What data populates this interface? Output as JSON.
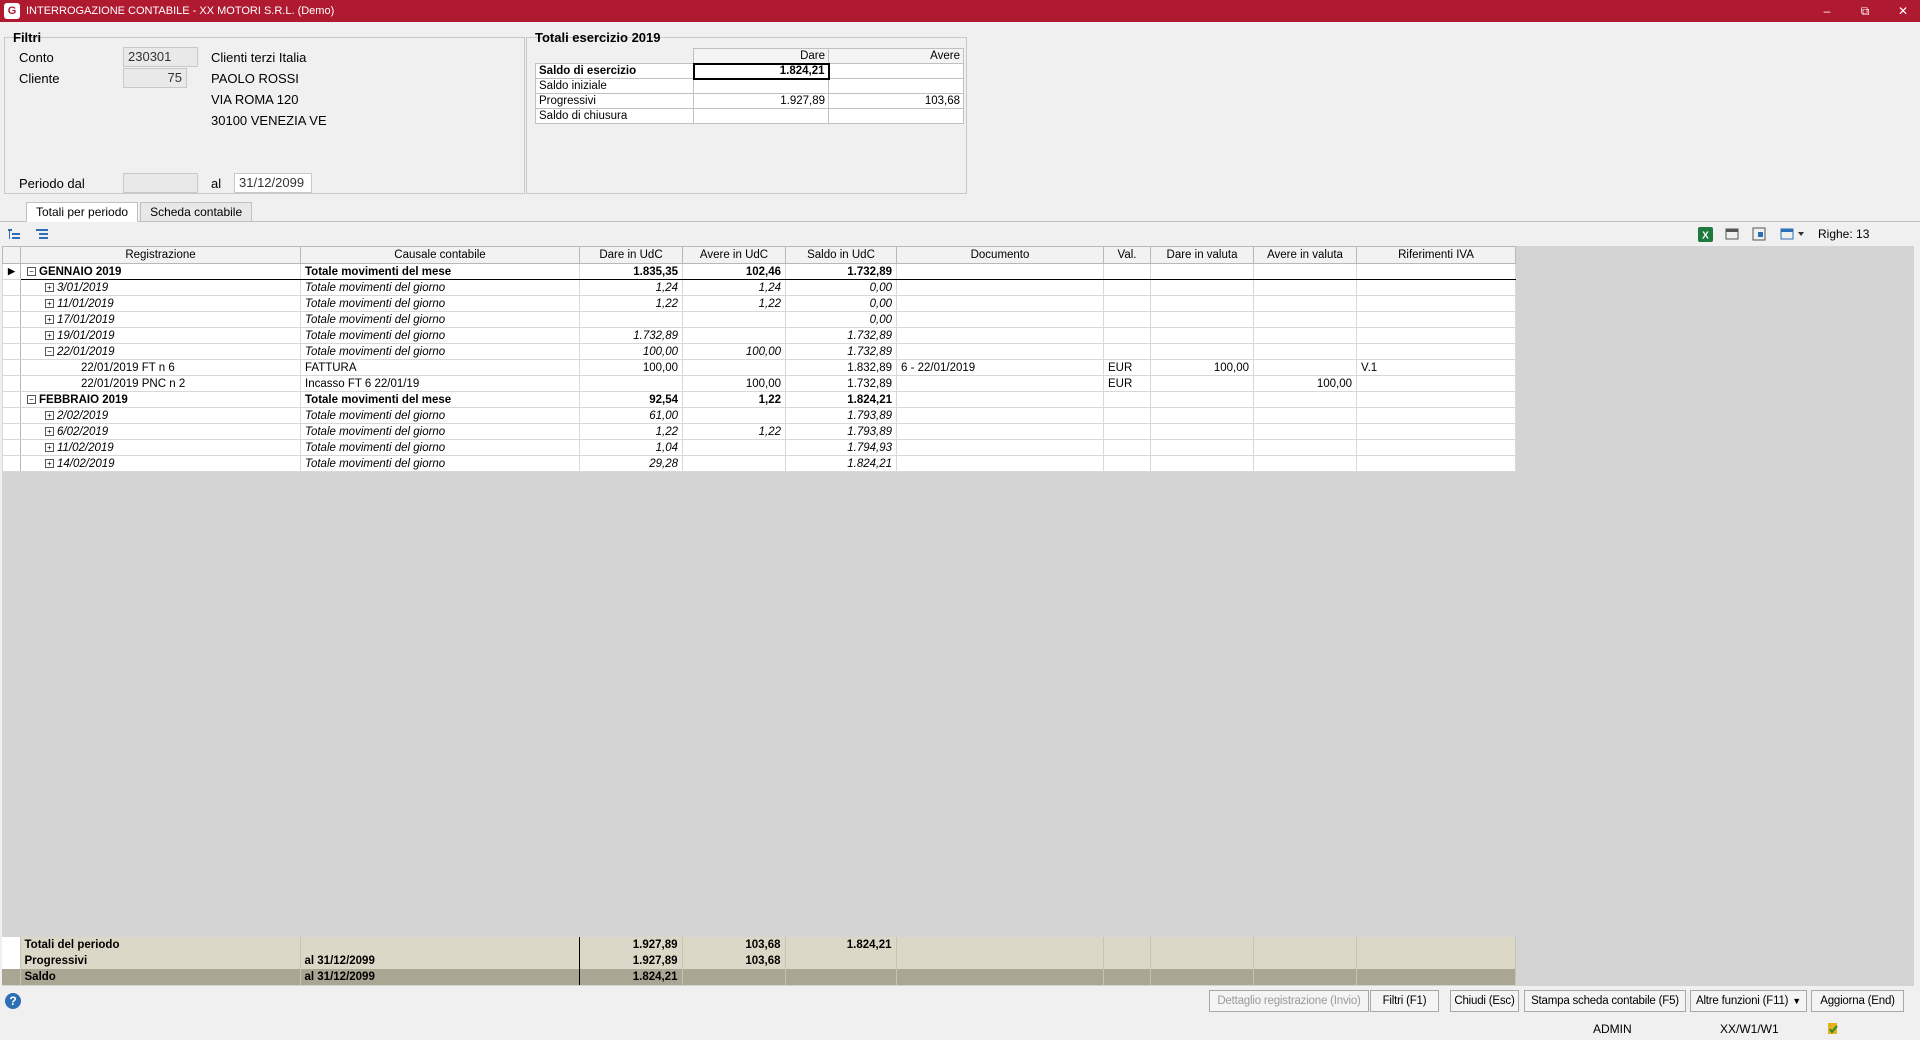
{
  "titlebar": {
    "title": "INTERROGAZIONE CONTABILE - XX MOTORI S.R.L. (Demo)"
  },
  "filters": {
    "title": "Filtri",
    "conto_label": "Conto",
    "conto_value": "230301",
    "conto_desc": "Clienti terzi Italia",
    "cliente_label": "Cliente",
    "cliente_value": "75",
    "cliente_name": "PAOLO ROSSI",
    "address1": "VIA ROMA 120",
    "address2": "30100 VENEZIA VE",
    "periodo_label": "Periodo dal",
    "periodo_dal": "",
    "al_label": "al",
    "periodo_al": "31/12/2099"
  },
  "totals": {
    "title": "Totali esercizio 2019",
    "col_dare": "Dare",
    "col_avere": "Avere",
    "rows": [
      {
        "label": "Saldo di esercizio",
        "dare": "1.824,21",
        "avere": ""
      },
      {
        "label": "Saldo iniziale",
        "dare": "",
        "avere": ""
      },
      {
        "label": "Progressivi",
        "dare": "1.927,89",
        "avere": "103,68"
      },
      {
        "label": "Saldo di chiusura",
        "dare": "",
        "avere": ""
      }
    ]
  },
  "tabs": [
    "Totali per periodo",
    "Scheda contabile"
  ],
  "toolbar": {
    "righe": "Righe: 13"
  },
  "grid": {
    "columns": [
      "Registrazione",
      "Causale contabile",
      "Dare in UdC",
      "Avere in UdC",
      "Saldo in UdC",
      "Documento",
      "Val.",
      "Dare in valuta",
      "Avere in valuta",
      "Riferimenti IVA"
    ],
    "rows": [
      {
        "kind": "month",
        "reg": "GENNAIO 2019",
        "causale": "Totale movimenti del mese",
        "dare": "1.835,35",
        "avere": "102,46",
        "saldo": "1.732,89",
        "doc": "",
        "val": "",
        "dv": "",
        "av": "",
        "iva": ""
      },
      {
        "kind": "day",
        "reg": "3/01/2019",
        "causale": "Totale movimenti del giorno",
        "dare": "1,24",
        "avere": "1,24",
        "saldo": "0,00",
        "doc": "",
        "val": "",
        "dv": "",
        "av": "",
        "iva": ""
      },
      {
        "kind": "day",
        "reg": "11/01/2019",
        "causale": "Totale movimenti del giorno",
        "dare": "1,22",
        "avere": "1,22",
        "saldo": "0,00",
        "doc": "",
        "val": "",
        "dv": "",
        "av": "",
        "iva": ""
      },
      {
        "kind": "day",
        "reg": "17/01/2019",
        "causale": "Totale movimenti del giorno",
        "dare": "",
        "avere": "",
        "saldo": "0,00",
        "doc": "",
        "val": "",
        "dv": "",
        "av": "",
        "iva": ""
      },
      {
        "kind": "day",
        "reg": "19/01/2019",
        "causale": "Totale movimenti del giorno",
        "dare": "1.732,89",
        "avere": "",
        "saldo": "1.732,89",
        "doc": "",
        "val": "",
        "dv": "",
        "av": "",
        "iva": ""
      },
      {
        "kind": "day-open",
        "reg": "22/01/2019",
        "causale": "Totale movimenti del giorno",
        "dare": "100,00",
        "avere": "100,00",
        "saldo": "1.732,89",
        "doc": "",
        "val": "",
        "dv": "",
        "av": "",
        "iva": ""
      },
      {
        "kind": "detail",
        "reg": "22/01/2019 FT n 6",
        "causale": "FATTURA",
        "dare": "100,00",
        "avere": "",
        "saldo": "1.832,89",
        "doc": "6 - 22/01/2019",
        "val": "EUR",
        "dv": "100,00",
        "av": "",
        "iva": "V.1"
      },
      {
        "kind": "detail",
        "reg": "22/01/2019 PNC n 2",
        "causale": "Incasso FT 6 22/01/19",
        "dare": "",
        "avere": "100,00",
        "saldo": "1.732,89",
        "doc": "",
        "val": "EUR",
        "dv": "",
        "av": "100,00",
        "iva": ""
      },
      {
        "kind": "month",
        "reg": "FEBBRAIO 2019",
        "causale": "Totale movimenti del mese",
        "dare": "92,54",
        "avere": "1,22",
        "saldo": "1.824,21",
        "doc": "",
        "val": "",
        "dv": "",
        "av": "",
        "iva": ""
      },
      {
        "kind": "day",
        "reg": "2/02/2019",
        "causale": "Totale movimenti del giorno",
        "dare": "61,00",
        "avere": "",
        "saldo": "1.793,89",
        "doc": "",
        "val": "",
        "dv": "",
        "av": "",
        "iva": ""
      },
      {
        "kind": "day",
        "reg": "6/02/2019",
        "causale": "Totale movimenti del giorno",
        "dare": "1,22",
        "avere": "1,22",
        "saldo": "1.793,89",
        "doc": "",
        "val": "",
        "dv": "",
        "av": "",
        "iva": ""
      },
      {
        "kind": "day",
        "reg": "11/02/2019",
        "causale": "Totale movimenti del giorno",
        "dare": "1,04",
        "avere": "",
        "saldo": "1.794,93",
        "doc": "",
        "val": "",
        "dv": "",
        "av": "",
        "iva": ""
      },
      {
        "kind": "day",
        "reg": "14/02/2019",
        "causale": "Totale movimenti del giorno",
        "dare": "29,28",
        "avere": "",
        "saldo": "1.824,21",
        "doc": "",
        "val": "",
        "dv": "",
        "av": "",
        "iva": ""
      }
    ]
  },
  "footer": [
    {
      "kind": "tot",
      "label": "Totali del periodo",
      "causale": "",
      "dare": "1.927,89",
      "avere": "103,68",
      "saldo": "1.824,21"
    },
    {
      "kind": "prog",
      "label": "Progressivi",
      "causale": "al 31/12/2099",
      "dare": "1.927,89",
      "avere": "103,68",
      "saldo": ""
    },
    {
      "kind": "saldo",
      "label": "Saldo",
      "causale": "al 31/12/2099",
      "dare": "1.824,21",
      "avere": "",
      "saldo": ""
    }
  ],
  "buttons": {
    "dettaglio": "Dettaglio registrazione (Invio)",
    "filtri": "Filtri (F1)",
    "chiudi": "Chiudi (Esc)",
    "stampa": "Stampa scheda contabile (F5)",
    "altre": "Altre funzioni (F11)",
    "aggiorna": "Aggiorna (End)"
  },
  "status": {
    "user": "ADMIN",
    "workstation": "XX/W1/W1"
  },
  "colors": {
    "titlebar": "#b01a30",
    "footer_row": "#dcd8c8",
    "saldo_row": "#aaa694"
  }
}
